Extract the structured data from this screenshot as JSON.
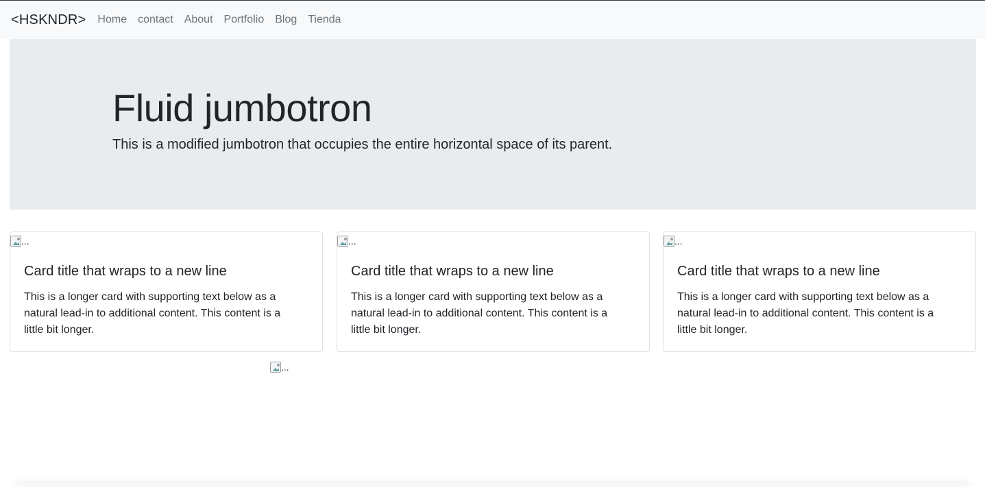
{
  "navbar": {
    "brand": "<HSKNDR>",
    "links": [
      "Home",
      "contact",
      "About",
      "Portfolio",
      "Blog",
      "Tienda"
    ]
  },
  "jumbotron": {
    "title": "Fluid jumbotron",
    "lead": "This is a modified jumbotron that occupies the entire horizontal space of its parent."
  },
  "cards": [
    {
      "img_alt": "...",
      "title": "Card title that wraps to a new line",
      "text": "This is a longer card with supporting text below as a natural lead-in to additional content. This content is a little bit longer."
    },
    {
      "img_alt": "...",
      "title": "Card title that wraps to a new line",
      "text": "This is a longer card with supporting text below as a natural lead-in to additional content. This content is a little bit longer."
    },
    {
      "img_alt": "...",
      "title": "Card title that wraps to a new line",
      "text": "This is a longer card with supporting text below as a natural lead-in to additional content. This content is a little bit longer."
    }
  ],
  "extra_image": {
    "img_alt": "..."
  },
  "colors": {
    "navbar_bg": "#f8f9fa",
    "jumbotron_bg": "#e9ecef",
    "nav_link": "#6c757d",
    "text": "#212529"
  }
}
